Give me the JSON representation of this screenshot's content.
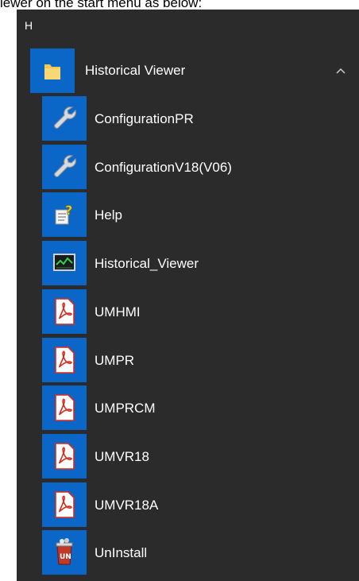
{
  "caption": "iewer on the start menu as below:",
  "menu": {
    "letter": "H",
    "group": {
      "label": "Historical Viewer",
      "icon": "folder-icon",
      "expanded": true
    },
    "items": [
      {
        "label": "ConfigurationPR",
        "icon": "wrench-icon"
      },
      {
        "label": "ConfigurationV18(V06)",
        "icon": "wrench-icon"
      },
      {
        "label": "Help",
        "icon": "help-document-icon"
      },
      {
        "label": "Historical_Viewer",
        "icon": "monitor-chart-icon"
      },
      {
        "label": "UMHMI",
        "icon": "pdf-icon"
      },
      {
        "label": "UMPR",
        "icon": "pdf-icon"
      },
      {
        "label": "UMPRCM",
        "icon": "pdf-icon"
      },
      {
        "label": "UMVR18",
        "icon": "pdf-icon"
      },
      {
        "label": "UMVR18A",
        "icon": "pdf-icon"
      },
      {
        "label": "UnInstall",
        "icon": "uninstall-bin-icon"
      }
    ]
  },
  "colors": {
    "menu_bg": "#2b2b2b",
    "tile_bg": "#0a67c8",
    "text": "#ffffff",
    "pdf_red": "#d52b1e",
    "folder_yellow": "#f2c94c"
  }
}
